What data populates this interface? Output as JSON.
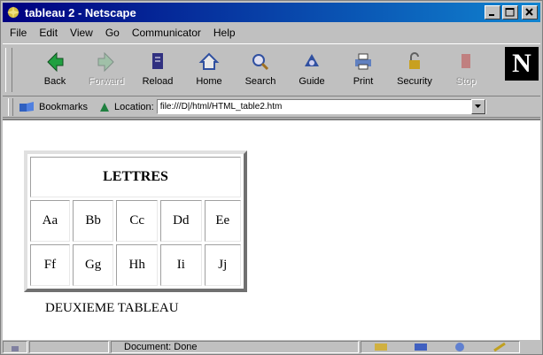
{
  "window": {
    "title": "tableau 2 - Netscape"
  },
  "menu": [
    {
      "label": "File"
    },
    {
      "label": "Edit"
    },
    {
      "label": "View"
    },
    {
      "label": "Go"
    },
    {
      "label": "Communicator"
    },
    {
      "label": "Help"
    }
  ],
  "toolbar": {
    "buttons": [
      {
        "label": "Back",
        "icon": "back-arrow-icon",
        "enabled": true
      },
      {
        "label": "Forward",
        "icon": "forward-arrow-icon",
        "enabled": false
      },
      {
        "label": "Reload",
        "icon": "reload-icon",
        "enabled": true
      },
      {
        "label": "Home",
        "icon": "home-icon",
        "enabled": true
      },
      {
        "label": "Search",
        "icon": "search-icon",
        "enabled": true
      },
      {
        "label": "Guide",
        "icon": "guide-icon",
        "enabled": true
      },
      {
        "label": "Print",
        "icon": "printer-icon",
        "enabled": true
      },
      {
        "label": "Security",
        "icon": "lock-icon",
        "enabled": true
      },
      {
        "label": "Stop",
        "icon": "stop-icon",
        "enabled": false
      }
    ],
    "logo_letter": "N"
  },
  "location": {
    "bookmarks_label": "Bookmarks",
    "location_label": "Location:",
    "url": "file:///D|/html/HTML_table2.htm"
  },
  "page": {
    "table": {
      "header": "LETTRES",
      "rows": [
        [
          "Aa",
          "Bb",
          "Cc",
          "Dd",
          "Ee"
        ],
        [
          "Ff",
          "Gg",
          "Hh",
          "Ii",
          "Jj"
        ]
      ]
    },
    "caption": "DEUXIEME TABLEAU"
  },
  "status": {
    "text": "Document: Done"
  }
}
